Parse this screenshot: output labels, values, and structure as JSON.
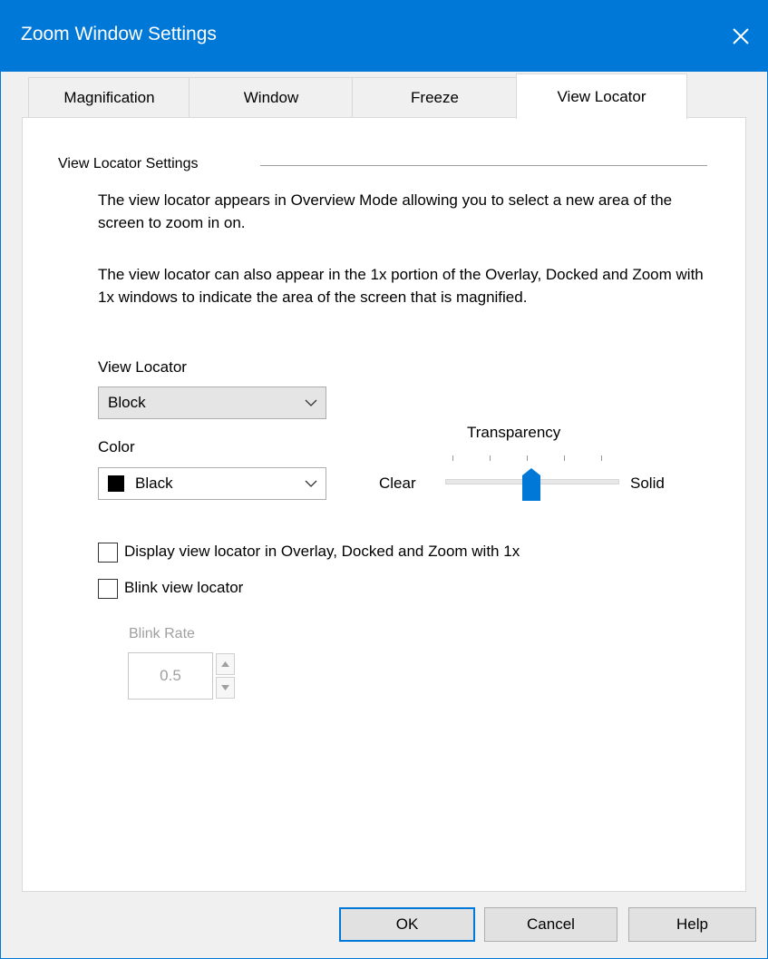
{
  "window": {
    "title": "Zoom Window Settings"
  },
  "tabs": [
    {
      "label": "Magnification"
    },
    {
      "label": "Window"
    },
    {
      "label": "Freeze"
    },
    {
      "label": "View Locator"
    }
  ],
  "group": {
    "title": "View Locator Settings",
    "paragraph1": "The view locator appears in Overview Mode allowing you to select a new area of the screen to zoom in on.",
    "paragraph2": "The view locator can also appear in the 1x portion of the Overlay, Docked and Zoom with 1x windows to indicate the area of the screen that is magnified."
  },
  "view_locator": {
    "label": "View Locator",
    "selected": "Block"
  },
  "color": {
    "label": "Color",
    "selected": "Black",
    "swatch": "#000000"
  },
  "transparency": {
    "label": "Transparency",
    "min_label": "Clear",
    "max_label": "Solid",
    "value_fraction": 0.5
  },
  "checkboxes": {
    "display_label": "Display view locator in Overlay, Docked and Zoom with 1x",
    "display_checked": false,
    "blink_label": "Blink view locator",
    "blink_checked": false
  },
  "blink_rate": {
    "label": "Blink Rate",
    "value": "0.5"
  },
  "buttons": {
    "ok": "OK",
    "cancel": "Cancel",
    "help": "Help"
  },
  "colors": {
    "accent": "#0078d7",
    "disabled_text": "#a0a0a0"
  }
}
